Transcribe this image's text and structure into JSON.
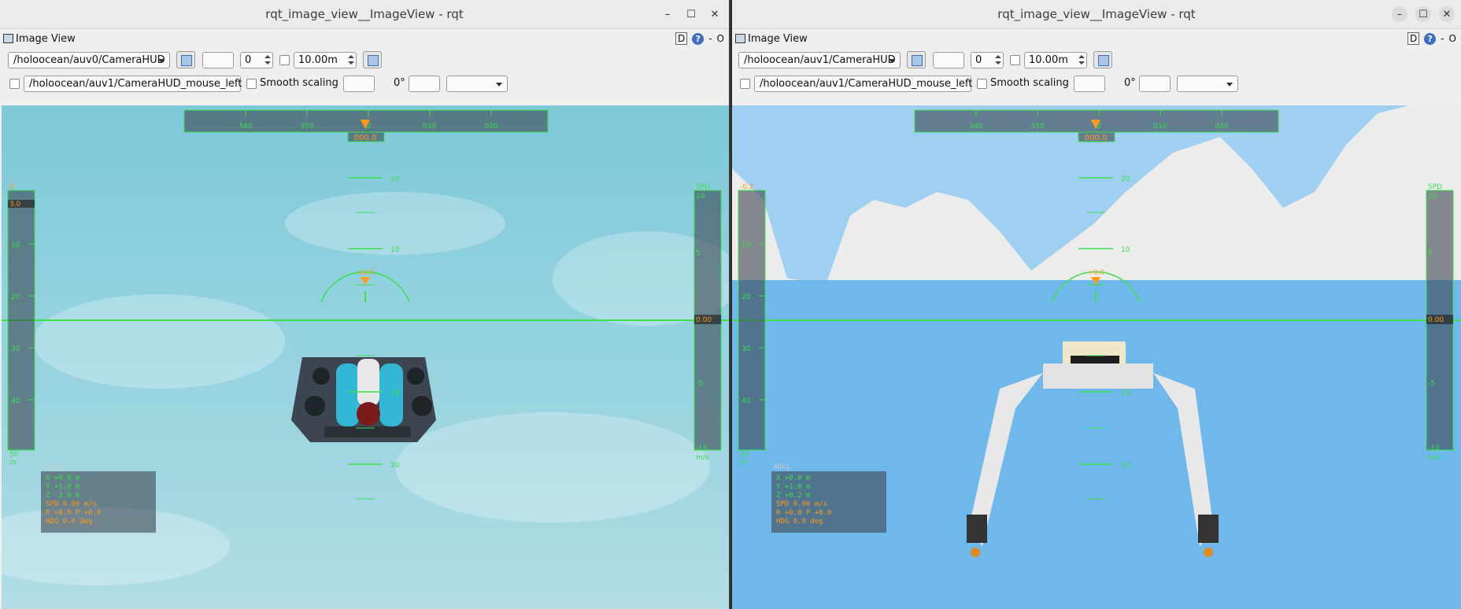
{
  "colors": {
    "hud_green": "#39e04a",
    "hud_orange": "#ff9a1a",
    "water_left": "#8fd0de",
    "sky_right": "#8ec7ee",
    "sea_right": "#66b4ea"
  },
  "windows": [
    {
      "title": "rqt_image_view__ImageView - rqt",
      "controls": {
        "minimize": "–",
        "maximize": "☐",
        "close": "✕"
      },
      "dock_title": "Image View",
      "dock_d": "D",
      "dock_help": "?",
      "dock_dash": "-",
      "dock_o": "O",
      "topic": "/holoocean/auv0/CameraHUD",
      "spin_value": "0",
      "distance": "10.00m",
      "mouse_topic": "/holoocean/auv1/CameraHUD_mouse_left",
      "smooth_scaling": "Smooth scaling",
      "rotation": "0°",
      "hud": {
        "heading_ticks": [
          "340",
          "350",
          "0",
          "010",
          "020"
        ],
        "heading_readout": "000.0",
        "pitch_labels": [
          "20",
          "10",
          "10",
          "20"
        ],
        "roll_readout": "+0.0",
        "left_scale_top": "0",
        "left_scale_value": "3.0",
        "left_scale_labels": [
          "10",
          "20",
          "30",
          "40"
        ],
        "left_scale_bottom": "50",
        "left_scale_unit": "m",
        "spd_label": "SPD",
        "spd_value": "0.00",
        "spd_labels": [
          "10",
          "5",
          "-5",
          "-10"
        ],
        "spd_unit": "m/s",
        "info_title": "AUV0",
        "info_lines": [
          "X     +0.0  m",
          "Y     +1.0  m",
          "Z     -3.0  m",
          "SPD   0.00  m/s",
          "R  +0.0   P  +0.0",
          "HDG       0.0  deg"
        ]
      }
    },
    {
      "title": "rqt_image_view__ImageView - rqt",
      "controls": {
        "minimize": "–",
        "maximize": "☐",
        "close": "✕"
      },
      "dock_title": "Image View",
      "dock_d": "D",
      "dock_help": "?",
      "dock_dash": "-",
      "dock_o": "O",
      "topic": "/holoocean/auv1/CameraHUD",
      "spin_value": "0",
      "distance": "10.00m",
      "mouse_topic": "/holoocean/auv1/CameraHUD_mouse_left",
      "smooth_scaling": "Smooth scaling",
      "rotation": "0°",
      "hud": {
        "heading_ticks": [
          "340",
          "350",
          "0",
          "010",
          "020"
        ],
        "heading_readout": "000.0",
        "pitch_labels": [
          "20",
          "10",
          "10",
          "20"
        ],
        "roll_readout": "+0.0",
        "left_scale_top": "-0.2",
        "left_scale_value": "",
        "left_scale_labels": [
          "10",
          "20",
          "30",
          "40"
        ],
        "left_scale_bottom": "50",
        "left_scale_unit": "m",
        "spd_label": "SPD",
        "spd_value": "0.00",
        "spd_labels": [
          "10",
          "5",
          "-5",
          "-10"
        ],
        "spd_unit": "m/s",
        "info_title": "AUV1",
        "info_lines": [
          "X     +0.0  m",
          "Y     +1.0  m",
          "Z     +0.2  m",
          "SPD   0.00  m/s",
          "R  +0.0   P  +0.0",
          "HDG       0.0  deg"
        ]
      }
    }
  ]
}
